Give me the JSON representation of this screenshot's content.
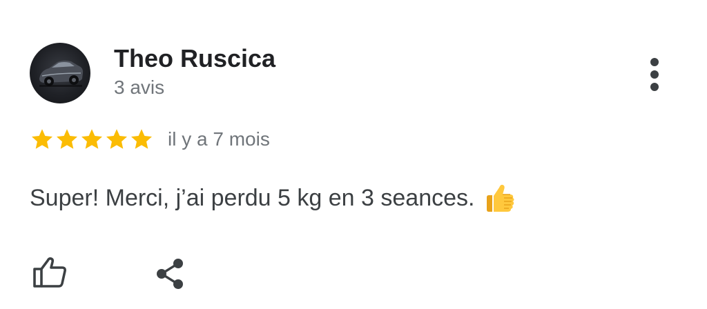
{
  "reviewer": {
    "name": "Theo Ruscica",
    "review_count": "3 avis",
    "avatar_icon": "car-photo-icon"
  },
  "review": {
    "rating": 5,
    "rating_max": 5,
    "date": "il y a 7 mois",
    "text": "Super! Merci, j’ai perdu 5 kg en 3 seances.",
    "emoji_icon": "thumbs-up-emoji-icon"
  },
  "actions": {
    "more_icon": "more-vertical-icon",
    "like_icon": "thumbs-up-outline-icon",
    "share_icon": "share-icon"
  },
  "colors": {
    "star": "#FBBC04",
    "name": "#202124",
    "secondary_text": "#70757a",
    "body_text": "#3c4043",
    "icon": "#3c4043"
  }
}
